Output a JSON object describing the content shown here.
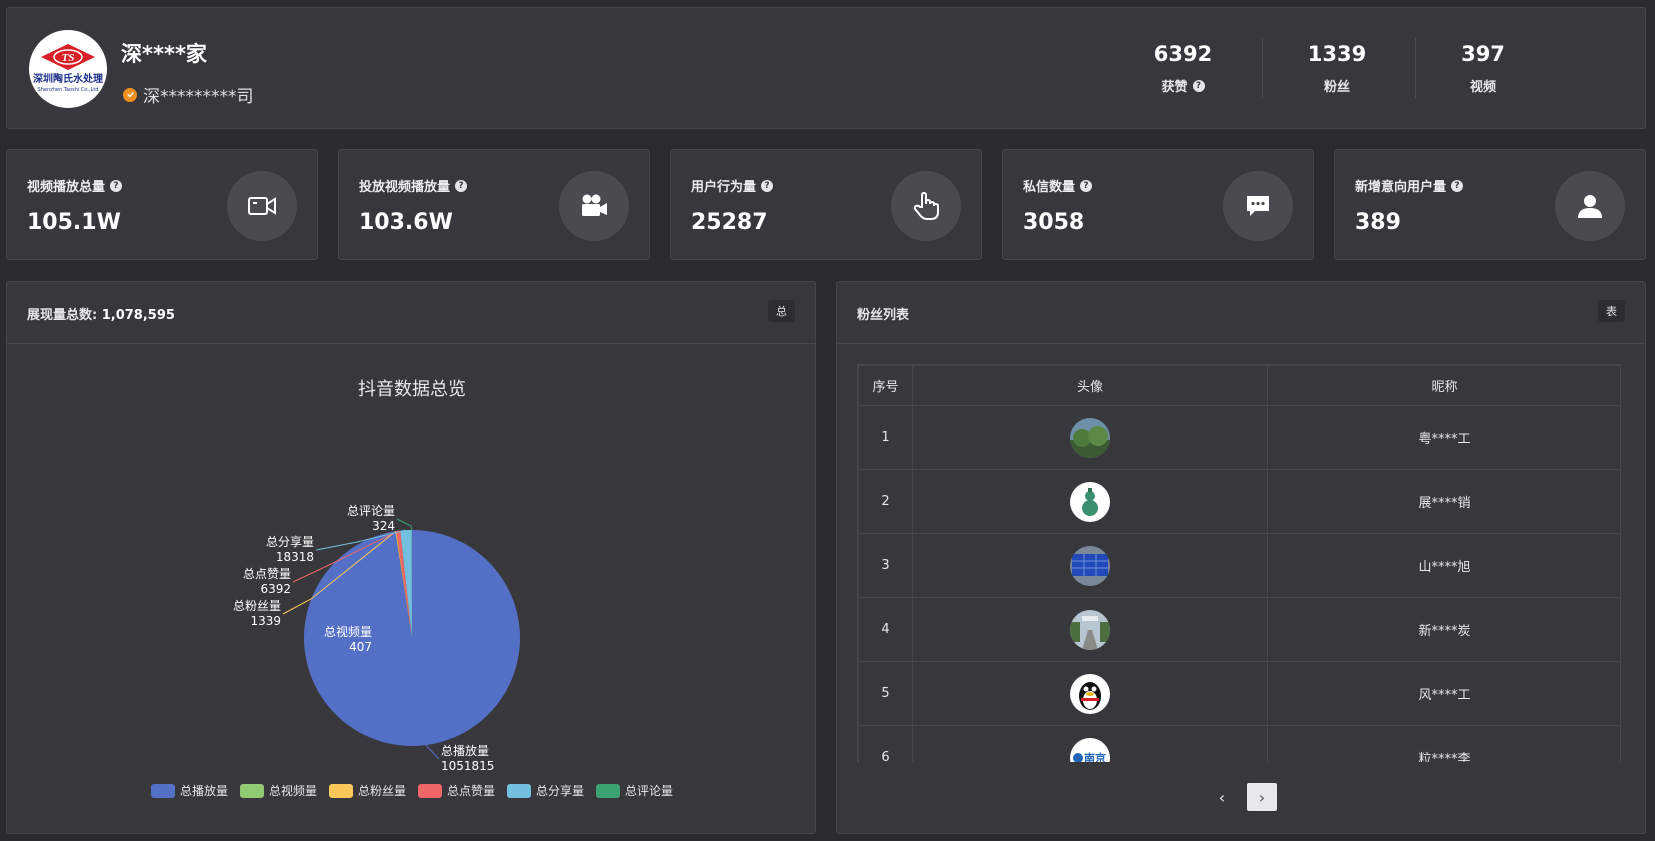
{
  "header": {
    "logo_text": "TS",
    "logo_cn": "深圳陶氏水处理",
    "logo_en": "Shenzhen Taoshi Co.,Ltd",
    "account_name": "深****家",
    "company": "深*********司",
    "stats": [
      {
        "value": "6392",
        "label": "获赞",
        "has_help": true
      },
      {
        "value": "1339",
        "label": "粉丝",
        "has_help": false
      },
      {
        "value": "397",
        "label": "视频",
        "has_help": false
      }
    ]
  },
  "cards": [
    {
      "label": "视频播放总量",
      "value": "105.1W",
      "icon": "video-camera-icon"
    },
    {
      "label": "投放视频播放量",
      "value": "103.6W",
      "icon": "film-camera-icon"
    },
    {
      "label": "用户行为量",
      "value": "25287",
      "icon": "hand-pointer-icon"
    },
    {
      "label": "私信数量",
      "value": "3058",
      "icon": "chat-bubble-icon"
    },
    {
      "label": "新增意向用户量",
      "value": "389",
      "icon": "user-icon"
    }
  ],
  "left_panel": {
    "title_prefix": "展现量总数:",
    "title_value": "1,078,595",
    "badge": "总"
  },
  "chart_data": {
    "type": "pie",
    "title": "抖音数据总览",
    "slices": [
      {
        "name": "总播放量",
        "value": 1051815,
        "color": "#5470c6"
      },
      {
        "name": "总视频量",
        "value": 407,
        "color": "#91cc75"
      },
      {
        "name": "总粉丝量",
        "value": 1339,
        "color": "#fac858"
      },
      {
        "name": "总点赞量",
        "value": 6392,
        "color": "#ee6666"
      },
      {
        "name": "总分享量",
        "value": 18318,
        "color": "#73c0de"
      },
      {
        "name": "总评论量",
        "value": 324,
        "color": "#3ba272"
      }
    ],
    "legend_position": "bottom"
  },
  "right_panel": {
    "title": "粉丝列表",
    "badge": "表",
    "columns": [
      "序号",
      "头像",
      "昵称"
    ],
    "rows": [
      {
        "index": "1",
        "nickname": "粤****工",
        "avatar": "landscape-avatar"
      },
      {
        "index": "2",
        "nickname": "展****销",
        "avatar": "gourd-avatar"
      },
      {
        "index": "3",
        "nickname": "山****旭",
        "avatar": "boxes-avatar"
      },
      {
        "index": "4",
        "nickname": "新****炭",
        "avatar": "street-avatar"
      },
      {
        "index": "5",
        "nickname": "风****工",
        "avatar": "penguin-avatar"
      },
      {
        "index": "6",
        "nickname": "粒****李",
        "avatar": "logo-avatar"
      }
    ],
    "row6_avatar_text": "南京",
    "pager": {
      "prev": "‹",
      "next": "›"
    }
  }
}
